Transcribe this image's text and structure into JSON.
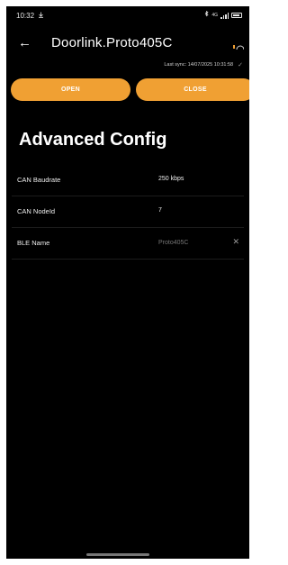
{
  "status_bar": {
    "time": "10:32",
    "download_icon": "download-arrow-icon",
    "bluetooth_icon": "bluetooth-icon",
    "network_label": "4G",
    "battery_icon": "battery-icon"
  },
  "header": {
    "back_icon": "back-arrow-icon",
    "title": "Doorlink.Proto405C",
    "status_icon": "connection-status-icon"
  },
  "sync": {
    "text": "Last sync: 14/07/2025 10:31:58",
    "icon": "check-icon"
  },
  "buttons": {
    "open_label": "OPEN",
    "close_label": "CLOSE"
  },
  "page_title": "Advanced Config",
  "config": [
    {
      "label": "CAN Baudrate",
      "value": "250 kbps"
    },
    {
      "label": "CAN NodeId",
      "value": "7"
    },
    {
      "label": "BLE Name",
      "placeholder": "Proto405C",
      "clear_icon": "clear-x-icon"
    }
  ],
  "colors": {
    "accent": "#f0a033",
    "background": "#000000"
  }
}
